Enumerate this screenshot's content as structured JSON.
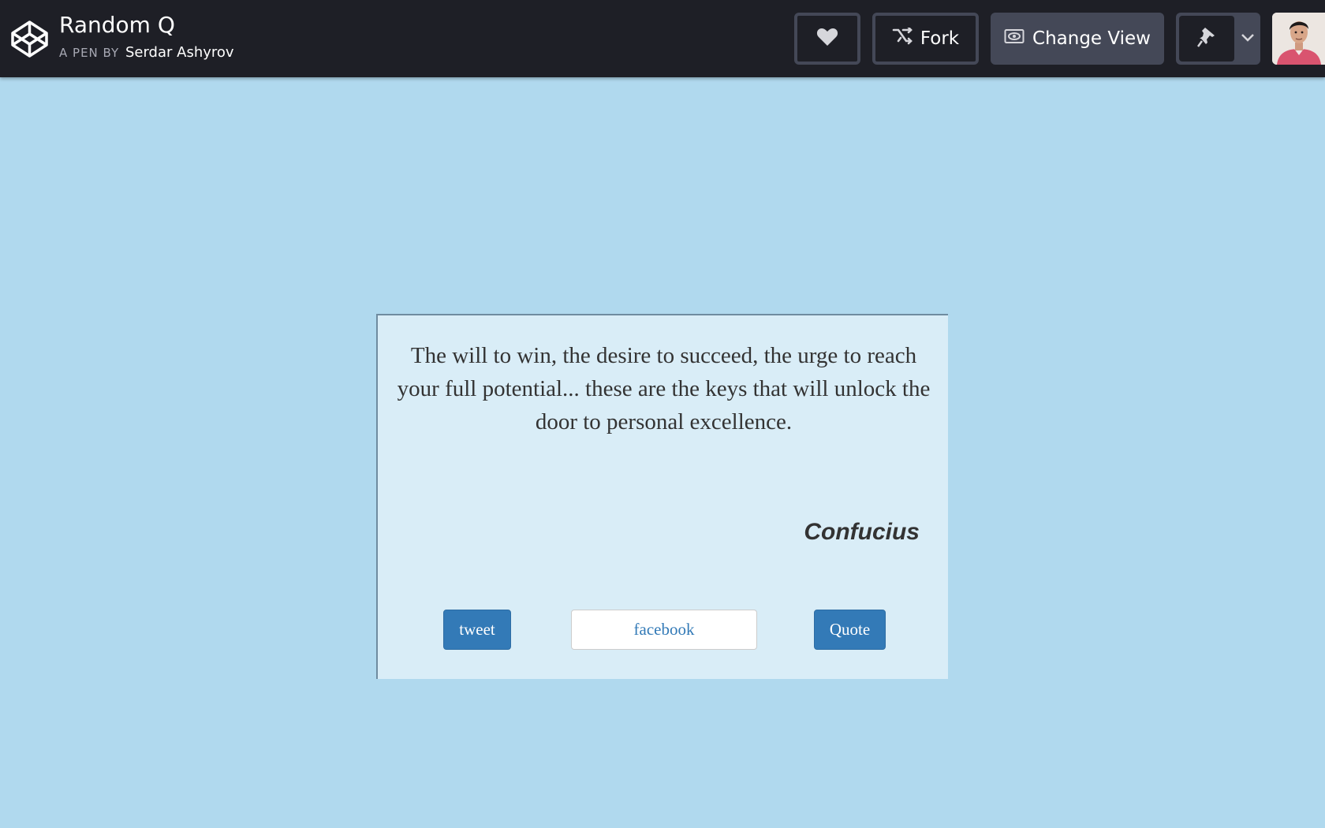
{
  "header": {
    "title": "Random Q",
    "byline_prefix": "A PEN BY",
    "author": "Serdar Ashyrov",
    "logo_icon": "codepen-cube-icon",
    "buttons": {
      "like_icon": "heart-icon",
      "fork_label": "Fork",
      "fork_icon": "fork-icon",
      "change_view_label": "Change View",
      "change_view_icon": "eye-icon",
      "pin_icon": "pin-icon",
      "caret_icon": "chevron-down-icon"
    },
    "avatar": "user-avatar"
  },
  "quote": {
    "text": "The will to win, the desire to succeed, the urge to reach your full potential... these are the keys that will unlock the door to personal excellence.",
    "author": "Confucius"
  },
  "actions": {
    "tweet_label": "tweet",
    "facebook_label": "facebook",
    "quote_label": "Quote"
  },
  "colors": {
    "page_bg": "#b0d9ee",
    "card_bg": "#d9edf7",
    "topbar_bg": "#1e1f26",
    "button_primary": "#337ab7"
  }
}
